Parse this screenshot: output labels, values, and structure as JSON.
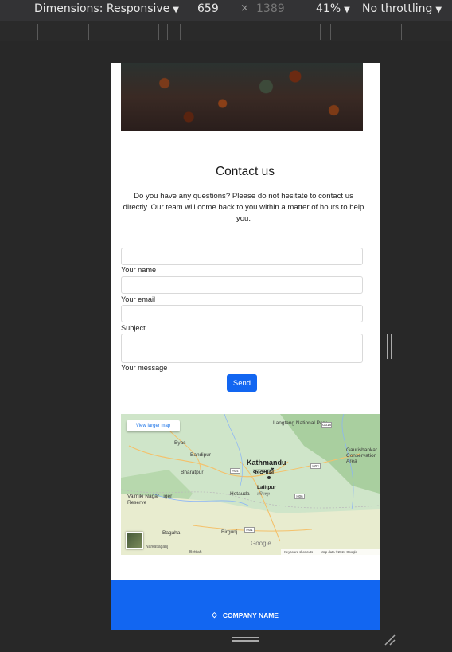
{
  "devtools": {
    "dimensions": "Dimensions: Responsive",
    "width": "659",
    "times": "×",
    "height": "1389",
    "zoom": "41%",
    "throttling": "No throttling"
  },
  "contact": {
    "title": "Contact us",
    "intro": "Do you have any questions? Please do not hesitate to contact us directly. Our team will come back to you within a matter of hours to help you.",
    "name_label": "Your name",
    "email_label": "Your email",
    "subject_label": "Subject",
    "message_label": "Your message",
    "send_label": "Send"
  },
  "map": {
    "view_larger": "View larger map",
    "places": {
      "kathmandu": "Kathmandu",
      "kathmandu_dev": "काठमाडौं",
      "langtang": "Langtang National Park",
      "gaurishankar": "Gaurishankar Conservation Area",
      "lalitpur": "Lalitpur",
      "lalitpur_dev": "ललितपुर",
      "bandipur": "Bandipur",
      "bharatpur": "Bharatpur",
      "hetauda": "Hetauda",
      "valmiki": "Valmiki Nagar Tiger Reserve",
      "bagaha": "Bagaha",
      "birgunj": "Birgunj",
      "byas": "Byas",
      "narkatiaganj": "Narkatiaganj",
      "bettiah": "Bettiah"
    },
    "google": "Google",
    "shortcuts": "Keyboard shortcuts",
    "mapdata": "Map data ©2024 Google"
  },
  "footer": {
    "company": "COMPANY NAME"
  },
  "colors": {
    "primary": "#1266f1",
    "devtools_bg": "#282828"
  }
}
